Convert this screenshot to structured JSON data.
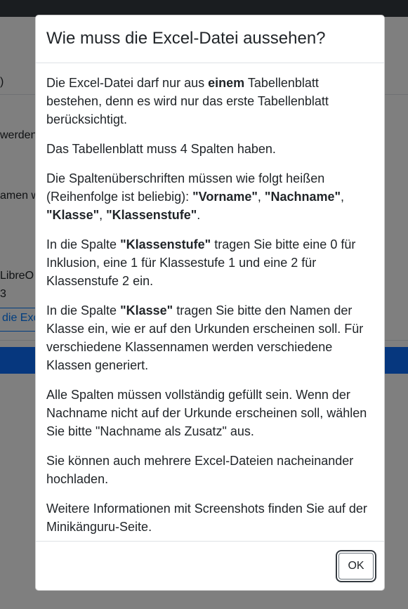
{
  "background": {
    "line_a": ")",
    "line_b": "werden",
    "line_c": "amen w",
    "line_d": "LibreO",
    "line_e": "3",
    "button": "die Exc"
  },
  "modal": {
    "title": "Wie muss die Excel-Datei aussehen?",
    "p1": {
      "a": "Die Excel-Datei darf nur aus ",
      "b": "einem",
      "c": " Tabellenblatt bestehen, denn es wird nur das erste Tabellenblatt berücksichtigt."
    },
    "p2": "Das Tabellenblatt muss 4 Spalten haben.",
    "p3": {
      "a": "Die Spaltenüberschriften müssen wie folgt heißen (Reihenfolge ist beliebig): ",
      "b": "\"Vorname\"",
      "c": ", ",
      "d": "\"Nachname\"",
      "e": ", ",
      "f": "\"Klasse\"",
      "g": ", ",
      "h": "\"Klassenstufe\"",
      "i": "."
    },
    "p4": {
      "a": "In die Spalte ",
      "b": "\"Klassenstufe\"",
      "c": " tragen Sie bitte eine 0 für Inklusion, eine 1 für Klassestufe 1 und eine 2 für Klassenstufe 2 ein."
    },
    "p5": {
      "a": "In die Spalte ",
      "b": "\"Klasse\"",
      "c": " tragen Sie bitte den Namen der Klasse ein, wie er auf den Urkunden erscheinen soll. Für verschiedene Klassennamen werden verschiedene Klassen generiert."
    },
    "p6": "Alle Spalten müssen vollständig gefüllt sein. Wenn der Nachname nicht auf der Urkunde erscheinen soll, wählen Sie bitte \"Nachname als Zusatz\" aus.",
    "p7": "Sie können auch mehrere Excel-Dateien nacheinander hochladen.",
    "p8": "Weitere Informationen mit Screenshots finden Sie auf der Minikänguru-Seite.",
    "ok_label": "OK"
  }
}
